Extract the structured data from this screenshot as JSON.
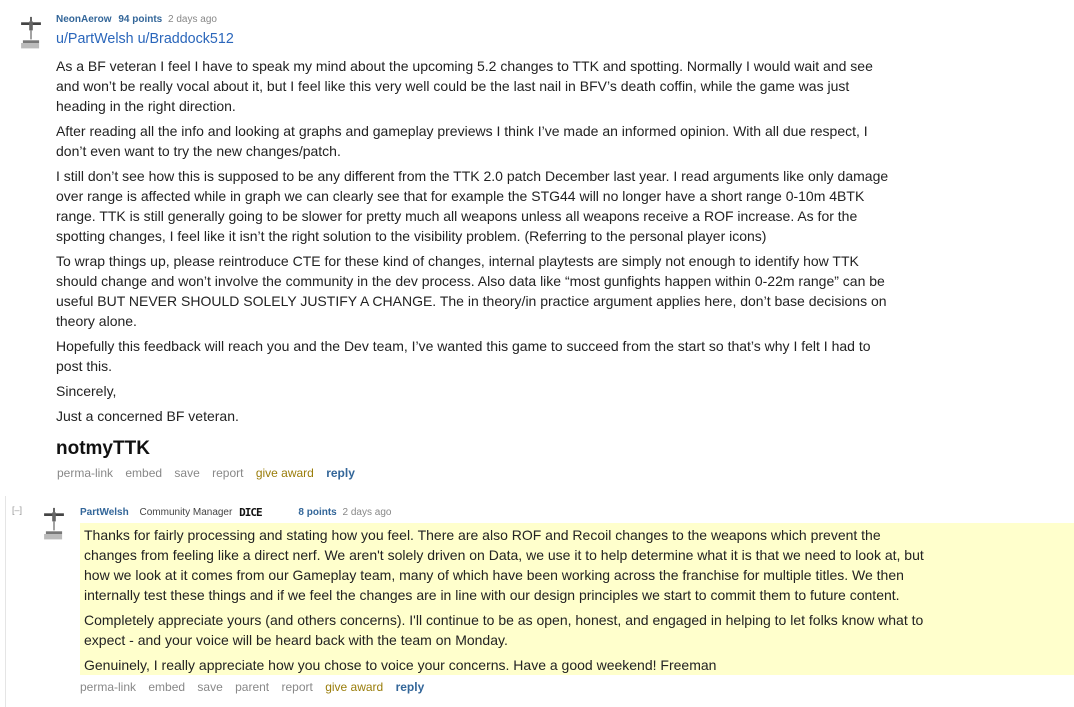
{
  "comment1": {
    "author": "NeonAerow",
    "score": "94 points",
    "time": "2 days ago",
    "mentions": [
      "u/PartWelsh",
      "u/Braddock512"
    ],
    "paragraphs": [
      "As a BF veteran I feel I have to speak my mind about the upcoming 5.2 changes to TTK and spotting. Normally I would wait and see and won’t be really vocal about it, but I feel like this very well could be the last nail in BFV’s death coffin, while the game was just heading in the right direction.",
      "After reading all the info and looking at graphs and gameplay previews I think I’ve made an informed opinion. With all due respect, I don’t even want to try the new changes/patch.",
      "I still don’t see how this is supposed to be any different from the TTK 2.0 patch December last year. I read arguments like only damage over range is affected while in graph we can clearly see that for example the STG44 will no longer have a short range 0-10m 4BTK range. TTK is still generally going to be slower for pretty much all weapons unless all weapons receive a ROF increase. As for the spotting changes, I feel like it isn’t the right solution to the visibility problem. (Referring to the personal player icons)",
      "To wrap things up, please reintroduce CTE for these kind of changes, internal playtests are simply not enough to identify how TTK should change and won’t involve the community in the dev process. Also data like “most gunfights happen within 0-22m range” can be useful BUT NEVER SHOULD SOLELY JUSTIFY A CHANGE. The in theory/in practice argument applies here, don’t base decisions on theory alone.",
      "Hopefully this feedback will reach you and the Dev team, I’ve wanted this game to succeed from the start so that’s why I felt I had to post this.",
      "Sincerely,",
      "Just a concerned BF veteran."
    ],
    "heading": "notmyTTK",
    "buttons": {
      "permalink": "perma-link",
      "embed": "embed",
      "save": "save",
      "report": "report",
      "give_award": "give award",
      "reply": "reply"
    }
  },
  "comment2": {
    "collapse": "[–]",
    "author": "PartWelsh",
    "flair": "Community Manager",
    "flair_logo_text": "DICE",
    "score": "8 points",
    "time": "2 days ago",
    "highlight_color": "#ffffcc",
    "paragraphs": [
      "Thanks for fairly processing and stating how you feel. There are also ROF and Recoil changes to the weapons which prevent the changes from feeling like a direct nerf. We aren't solely driven on Data, we use it to help determine what it is that we need to look at, but how we look at it comes from our Gameplay team, many of which have been working across the franchise for multiple titles. We then internally test these things and if we feel the changes are in line with our design principles we start to commit them to future content.",
      "Completely appreciate yours (and others concerns). I'll continue to be as open, honest, and engaged in helping to let folks know what to expect - and your voice will be heard back with the team on Monday.",
      "Genuinely, I really appreciate how you chose to voice your concerns. Have a good weekend! Freeman"
    ],
    "buttons": {
      "permalink": "perma-link",
      "embed": "embed",
      "save": "save",
      "parent": "parent",
      "report": "report",
      "give_award": "give award",
      "reply": "reply"
    }
  },
  "colors": {
    "link": "#369",
    "award": "#9a7d0a",
    "meta": "#888"
  },
  "icons": {
    "avatar": "plane-flair-icon",
    "dice_logo": "dice-logo-icon"
  }
}
